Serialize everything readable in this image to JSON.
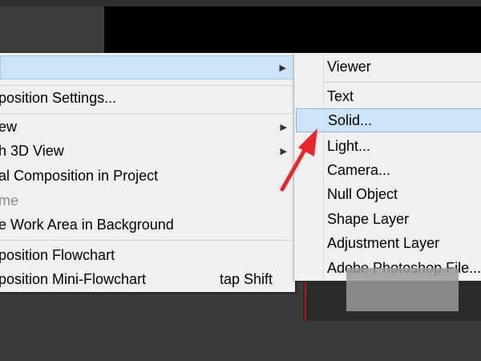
{
  "context_menu": {
    "items": [
      {
        "label": "",
        "has_submenu": true
      },
      {
        "label": "position Settings..."
      },
      {
        "label": "ew",
        "has_submenu": true
      },
      {
        "label": "h 3D View",
        "has_submenu": true
      },
      {
        "label": "al Composition in Project"
      },
      {
        "label": "me",
        "disabled": true
      },
      {
        "label": "e Work Area in Background"
      },
      {
        "label": "position Flowchart"
      },
      {
        "label": "position Mini-Flowchart",
        "shortcut": "tap Shift"
      }
    ]
  },
  "submenu": {
    "items": [
      {
        "label": "Viewer"
      },
      {
        "label": "Text"
      },
      {
        "label": "Solid..."
      },
      {
        "label": "Light..."
      },
      {
        "label": "Camera..."
      },
      {
        "label": "Null Object"
      },
      {
        "label": "Shape Layer"
      },
      {
        "label": "Adjustment Layer"
      },
      {
        "label": "Adobe Photoshop File..."
      }
    ]
  },
  "colors": {
    "highlight": "#cde3f7",
    "annotation_arrow": "#e8262d",
    "menu_bg": "#f0f0f0",
    "viewer_bg": "#000000"
  },
  "icons": {
    "submenu_arrow": "chevron-right-icon",
    "annotation": "red-arrow-icon"
  }
}
